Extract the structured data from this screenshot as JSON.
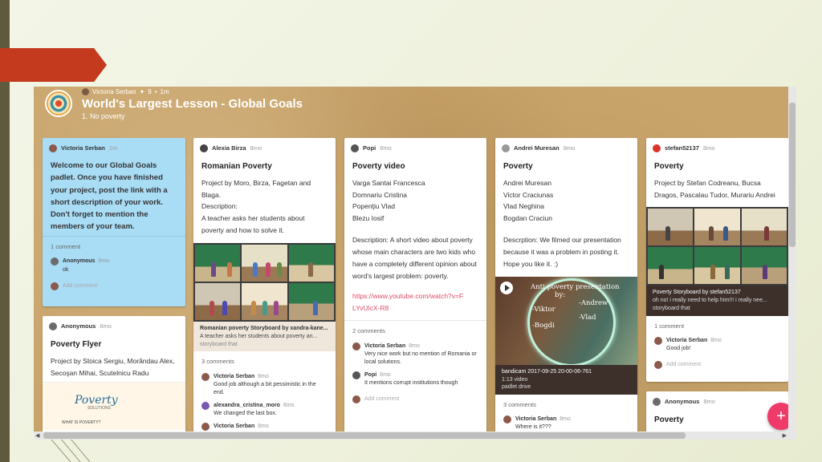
{
  "slide": {
    "accent_color": "#c33a1e"
  },
  "padlet": {
    "author": "Victoria Serban",
    "likes": "9",
    "age": "1m",
    "title": "World's Largest Lesson - Global Goals",
    "subtitle": "1. No poverty"
  },
  "cards": {
    "welcome": {
      "author": "Victoria Serban",
      "time": "1m",
      "body": "Welcome to our Global Goals padlet. Once you have finished your project, post the link with a short description of your work. Don't forget to mention the members of your team.",
      "comments_count": "1 comment",
      "comments": [
        {
          "name": "Anonymous",
          "time": "8mo",
          "text": "ok"
        }
      ],
      "add_comment": "Add comment"
    },
    "flyer": {
      "author": "Anonymous",
      "time": "8mo",
      "title": "Poverty Flyer",
      "body": "Project by Stoica Sergiu, Morândau Alex, Secoşan Mihai, Scutelnicu Radu",
      "image_title": "Poverty",
      "image_sub": "SOLUTIONS",
      "image_bottom": "WHAT IS POVERTY?"
    },
    "romanian": {
      "author": "Alexia Birza",
      "time": "8mo",
      "title": "Romanian Poverty",
      "body1": "Project by Moro, Birza, Fagetan and Blaga.",
      "body2": "Description:",
      "body3": "A teacher asks her students about poverty and how to solve it.",
      "attach_title": "Romanian poverty Storyboard by xandra-kane...",
      "attach_desc": "A teacher asks her students about poverty an...",
      "attach_src": "storyboard that",
      "comments_count": "3 comments",
      "comments": [
        {
          "name": "Victoria Serban",
          "time": "8mo",
          "text": "Good job although a bit pessimistic in the end."
        },
        {
          "name": "alexandra_cristina_moro",
          "time": "8mo",
          "text": "We changed the last box."
        },
        {
          "name": "Victoria Serban",
          "time": "8mo",
          "text": ""
        }
      ]
    },
    "video": {
      "author": "Popi",
      "time": "8mo",
      "title": "Poverty video",
      "members": [
        "Varga Santai Francesca",
        "Domnariu Cristina",
        "Popenţiu Vlad",
        "Blezu Iosif"
      ],
      "description": "Description: A short video about poverty whose main characters are  two kids who have a completely different opinion about word's largest problem: poverty.",
      "link": "https://www.youtube.com/watch?v=FLYvUlcX-R8",
      "comments_count": "2 comments",
      "comments": [
        {
          "name": "Victoria Serban",
          "time": "8mo",
          "text": "Very nice work but no mention of Romania or local solutions."
        },
        {
          "name": "Popi",
          "time": "8mo",
          "text": "It mentions corrupt institutions though"
        }
      ],
      "add_comment": "Add comment"
    },
    "andrei": {
      "author": "Andrei Muresan",
      "time": "8mo",
      "title": "Poverty",
      "members": [
        "Andrei Muresan",
        "Victor Craciunas",
        "Vlad Neghina",
        "Bogdan Craciun"
      ],
      "description": "Descrption: We filmed our presentation because it was a problem in posting it. Hope you like it. :)",
      "video_heading": "Anti-poverty presentation",
      "video_by": "by:",
      "video_names": [
        "-Andrew",
        "-Viktor",
        "-Vlad",
        "-Bogdi"
      ],
      "attach_title": "bandicam 2017-09-25 20-00-06-761",
      "attach_desc": "1:13 video",
      "attach_src": "padlet drive",
      "comments_count": "3 comments",
      "comments": [
        {
          "name": "Victoria Serban",
          "time": "8mo",
          "text": "Where is it???"
        }
      ]
    },
    "stefan": {
      "author": "stefan52137",
      "time": "8mo",
      "title": "Poverty",
      "body": "Project by Stefan Codreanu, Bucsa Dragos, Pascalau Tudor, Murariu Andrei",
      "attach_title": "Poverty Storyboard by stefan52137",
      "attach_desc": "oh no! i really need to help him!!! i really nee...",
      "attach_src": "storyboard that",
      "comments_count": "1 comment",
      "comments": [
        {
          "name": "Victoria Serban",
          "time": "8mo",
          "text": "Good job!"
        }
      ],
      "add_comment": "Add comment"
    },
    "anon_poverty": {
      "author": "Anonymous",
      "time": "8mo",
      "title": "Poverty"
    }
  },
  "fab": {
    "label": "+"
  }
}
